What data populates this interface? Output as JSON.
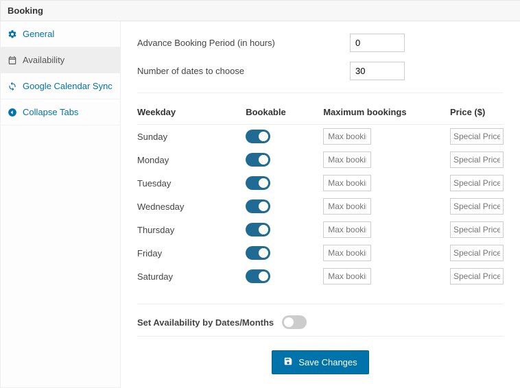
{
  "panel_title": "Booking",
  "sidebar": {
    "items": [
      {
        "label": "General",
        "icon": "gear"
      },
      {
        "label": "Availability",
        "icon": "calendar"
      },
      {
        "label": "Google Calendar Sync",
        "icon": "sync"
      },
      {
        "label": "Collapse Tabs",
        "icon": "arrow-left"
      }
    ],
    "active_index": 1
  },
  "settings": {
    "advance_label": "Advance Booking Period (in hours)",
    "advance_value": "0",
    "numdates_label": "Number of dates to choose",
    "numdates_value": "30"
  },
  "table": {
    "headers": {
      "weekday": "Weekday",
      "bookable": "Bookable",
      "max": "Maximum bookings",
      "price": "Price ($)"
    },
    "max_placeholder": "Max bookings",
    "price_placeholder": "Special Price",
    "rows": [
      {
        "day": "Sunday",
        "bookable": true
      },
      {
        "day": "Monday",
        "bookable": true
      },
      {
        "day": "Tuesday",
        "bookable": true
      },
      {
        "day": "Wednesday",
        "bookable": true
      },
      {
        "day": "Thursday",
        "bookable": true
      },
      {
        "day": "Friday",
        "bookable": true
      },
      {
        "day": "Saturday",
        "bookable": true
      }
    ]
  },
  "dates_months": {
    "label": "Set Availability by Dates/Months",
    "enabled": false
  },
  "buttons": {
    "save": "Save Changes"
  }
}
